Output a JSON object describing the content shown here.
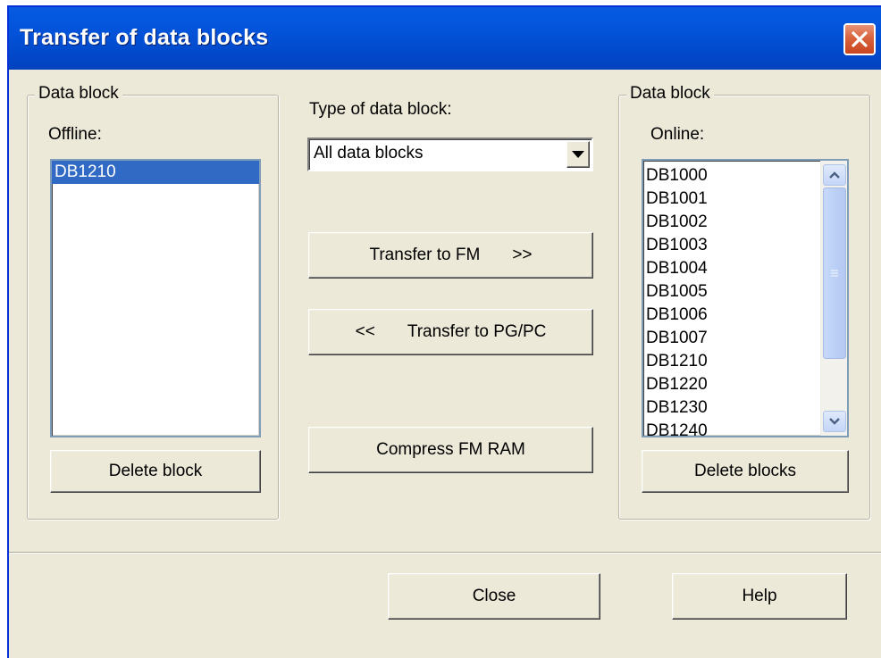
{
  "window": {
    "title": "Transfer of data blocks"
  },
  "offline_group": {
    "legend": "Data block",
    "label": "Offline:",
    "items": [
      "DB1210"
    ],
    "selected_index": 0,
    "delete_label": "Delete block"
  },
  "middle": {
    "type_label": "Type of data block:",
    "type_value": "All data blocks",
    "transfer_to_fm": {
      "text": "Transfer to FM",
      "arrow": ">>"
    },
    "transfer_to_pg": {
      "arrow": "<<",
      "text": "Transfer to PG/PC"
    },
    "compress_label": "Compress FM RAM"
  },
  "online_group": {
    "legend": "Data block",
    "label": "Online:",
    "items": [
      "DB1000",
      "DB1001",
      "DB1002",
      "DB1003",
      "DB1004",
      "DB1005",
      "DB1006",
      "DB1007",
      "DB1210",
      "DB1220",
      "DB1230",
      "DB1240"
    ],
    "delete_label": "Delete blocks"
  },
  "footer": {
    "close_label": "Close",
    "help_label": "Help"
  },
  "colors": {
    "title_bar": "#0353d9",
    "selection": "#316ac5",
    "dialog_bg": "#ece9d8",
    "close_button": "#d8633e"
  }
}
